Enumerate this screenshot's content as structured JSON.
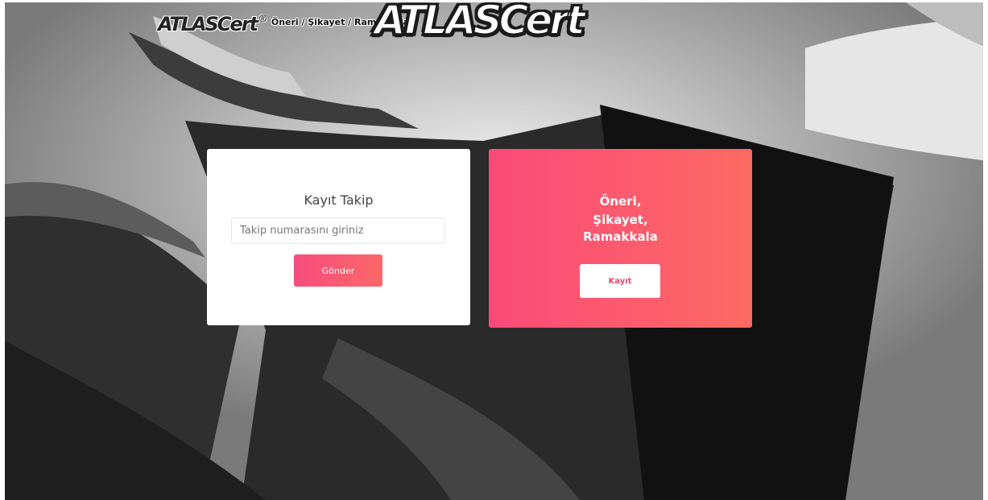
{
  "header": {
    "logo_small": "ATLASCert",
    "registered_mark": "®",
    "breadcrumb": "Öneri / Şikayet / Ramakkala",
    "logo_big": "ATLASCert"
  },
  "tracking_card": {
    "title": "Kayıt Takip",
    "input_value": "",
    "input_placeholder": "Takip numarasını giriniz",
    "submit_label": "Gönder"
  },
  "register_card": {
    "line1": "Öneri,",
    "line2": "Şikayet,",
    "line3": "Ramakkala",
    "button_label": "Kayıt"
  },
  "colors": {
    "accent_start": "#fb4a7a",
    "accent_end": "#fd6a62",
    "button_text": "#e8476e"
  },
  "icons": {
    "background": "hero-photo-grayscale"
  }
}
